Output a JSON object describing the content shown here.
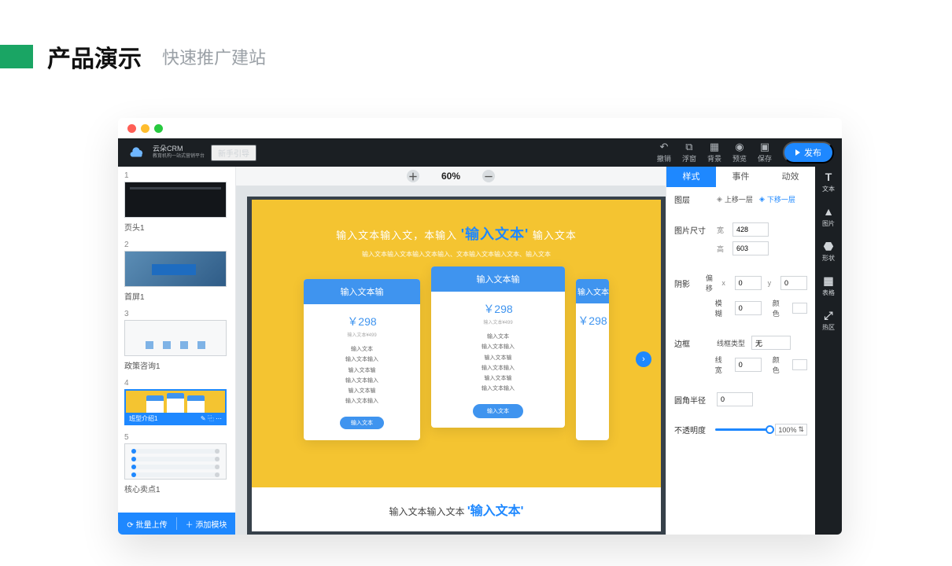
{
  "slide": {
    "title": "产品演示",
    "subtitle": "快速推广建站"
  },
  "topbar": {
    "brand_line1": "云朵CRM",
    "brand_line2": "教育机构一站式营销平台",
    "newbie": "新手引导",
    "undo": "撤销",
    "float": "浮窗",
    "bg": "背景",
    "preview": "预览",
    "save": "保存",
    "publish": "发布"
  },
  "zoom": {
    "value": "60%"
  },
  "pages": {
    "items": [
      {
        "label": "页头1"
      },
      {
        "label": "首屏1"
      },
      {
        "label": "政策咨询1"
      },
      {
        "label": "班型介绍1"
      },
      {
        "label": "核心卖点1"
      }
    ],
    "batch": "批量上传",
    "add": "添加模块"
  },
  "canvas": {
    "headline_pre": "输入文本输入文，本输入 ",
    "headline_q": "'输入文本'",
    "headline_post": " 输入文本",
    "subhead": "输入文本输入文本输入文本输入、文本输入文本输入文本、输入文本",
    "card": {
      "title": "输入文本输",
      "price": "￥298",
      "price_sub": "输入文本¥499",
      "features": [
        "输入文本",
        "输入文本输入",
        "输入文本输",
        "输入文本输入",
        "输入文本输",
        "输入文本输入"
      ],
      "btn": "输入文本"
    },
    "foot_pre": "输入文本输入文本 ",
    "foot_q": "'输入文本'"
  },
  "inspector": {
    "tab_style": "样式",
    "tab_event": "事件",
    "tab_anim": "动效",
    "layer": "图层",
    "up": "上移一层",
    "down": "下移一层",
    "size": "图片尺寸",
    "w": "宽",
    "h": "高",
    "w_val": "428",
    "h_val": "603",
    "shadow": "阴影",
    "offset": "偏移",
    "x": "x",
    "y": "y",
    "x_val": "0",
    "y_val": "0",
    "blur": "模糊",
    "blur_val": "0",
    "color": "颜色",
    "border": "边框",
    "line_type": "线框类型",
    "line_type_val": "无",
    "line_w": "线宽",
    "line_w_val": "0",
    "radius": "圆角半径",
    "radius_val": "0",
    "opacity": "不透明度",
    "opacity_val": "100%"
  },
  "tools": {
    "text": "文本",
    "image": "图片",
    "shape": "形状",
    "table": "表格",
    "hot": "热区"
  }
}
